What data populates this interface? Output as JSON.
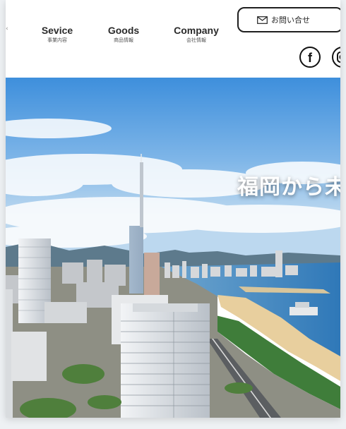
{
  "nav": {
    "items": [
      {
        "label": "Sevice",
        "sub": "事業内容"
      },
      {
        "label": "Goods",
        "sub": "商品情報"
      },
      {
        "label": "Company",
        "sub": "会社情報"
      }
    ],
    "contact_label": "お問い合せ"
  },
  "social": {
    "icons": [
      "facebook-icon",
      "instagram-icon"
    ]
  },
  "hero": {
    "title": "福岡から未",
    "image": "aerial-city-coast-photo"
  },
  "colors": {
    "sky": "#3f8fd9",
    "sea": "#3a86c8",
    "text_dark": "#2b2b2b"
  }
}
